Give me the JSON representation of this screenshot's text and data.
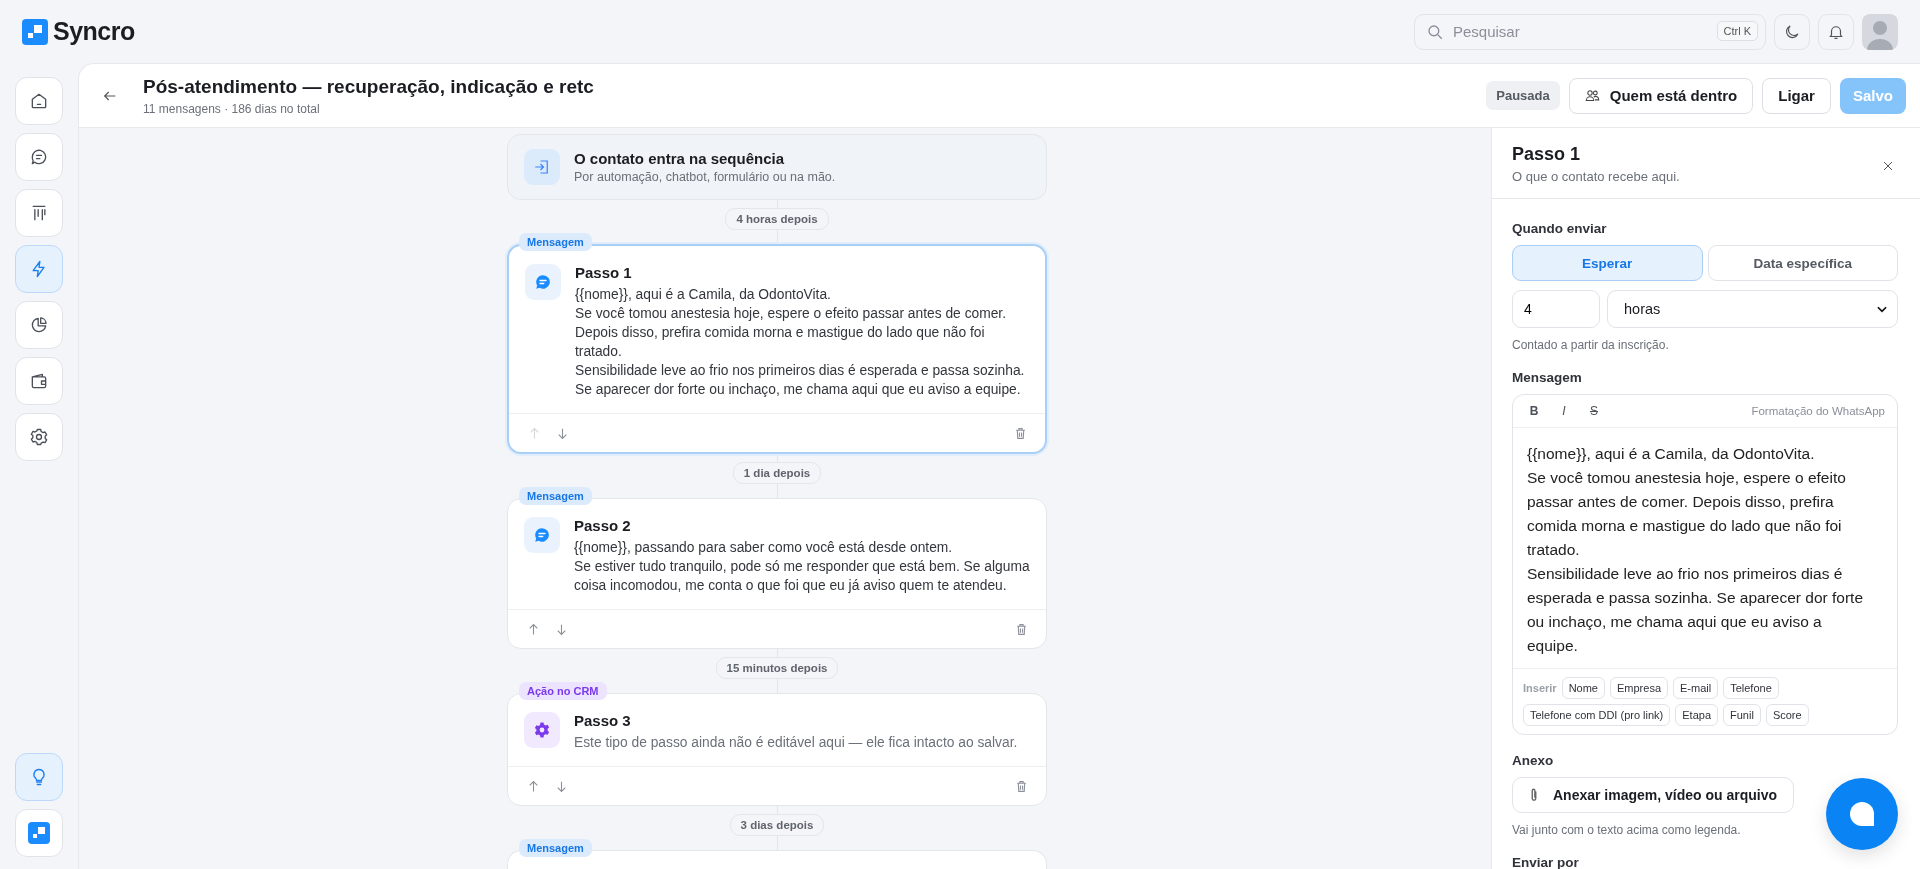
{
  "app": {
    "logo": "Syncro"
  },
  "search": {
    "placeholder": "Pesquisar",
    "shortcut": "Ctrl K"
  },
  "sidebar": {
    "items": [
      {
        "kind": "home",
        "selected": false
      },
      {
        "kind": "chat",
        "selected": false
      },
      {
        "kind": "board",
        "selected": false
      },
      {
        "kind": "automation",
        "selected": true
      },
      {
        "kind": "reports",
        "selected": false
      },
      {
        "kind": "wallet",
        "selected": false
      },
      {
        "kind": "settings",
        "selected": false
      }
    ],
    "bottom_items": [
      {
        "kind": "bulb",
        "selected": true
      },
      {
        "kind": "logo",
        "selected": false
      }
    ]
  },
  "header": {
    "title": "Pós-atendimento — recuperação, indicação e retc",
    "subtitle": "11 mensagens · 186 dias no total",
    "actions": [
      {
        "label": "Pausada",
        "kind": "status"
      },
      {
        "label": "Quem está dentro",
        "kind": "people"
      },
      {
        "label": "Ligar",
        "kind": "plain"
      },
      {
        "label": "Salvo",
        "kind": "primary",
        "disabled": true
      }
    ]
  },
  "flow": {
    "entry": {
      "title": "O contato entra na sequência",
      "subtitle": "Por automação, chatbot, formulário ou na mão."
    },
    "steps": [
      {
        "delay": "4 horas depois",
        "tag": "Mensagem",
        "kind": "message",
        "title": "Passo 1",
        "body": "{{nome}}, aqui é a Camila, da OdontoVita.\nSe você tomou anestesia hoje, espere o efeito passar antes de comer. Depois disso, prefira comida morna e mastigue do lado que não foi tratado.\nSensibilidade leve ao frio nos primeiros dias é esperada e passa sozinha.\nSe aparecer dor forte ou inchaço, me chama aqui que eu aviso a equipe.",
        "selected": true,
        "up_disabled": true
      },
      {
        "delay": "1 dia depois",
        "tag": "Mensagem",
        "kind": "message",
        "title": "Passo 2",
        "body": "{{nome}}, passando para saber como você está desde ontem.\nSe estiver tudo tranquilo, pode só me responder que está bem. Se alguma coisa incomodou, me conta o que foi que eu já aviso quem te atendeu.",
        "selected": false,
        "up_disabled": false
      },
      {
        "delay": "15 minutos depois",
        "tag": "Ação no CRM",
        "kind": "crm",
        "title": "Passo 3",
        "body": "Este tipo de passo ainda não é editável aqui — ele fica intacto ao salvar.",
        "selected": false,
        "up_disabled": false
      }
    ],
    "next": {
      "delay": "3 dias depois",
      "tag": "Mensagem",
      "kind": "message"
    }
  },
  "panel": {
    "title": "Passo 1",
    "subtitle": "O que o contato recebe aqui.",
    "when_label": "Quando enviar",
    "modes": [
      {
        "label": "Esperar",
        "selected": true
      },
      {
        "label": "Data específica",
        "selected": false
      }
    ],
    "amount": "4",
    "unit": "horas",
    "hint": "Contado a partir da inscrição.",
    "message_label": "Mensagem",
    "format_buttons": [
      {
        "label": "B",
        "kind": "bold"
      },
      {
        "label": "I",
        "kind": "italic"
      },
      {
        "label": "S",
        "kind": "strike"
      }
    ],
    "format_hint": "Formatação do WhatsApp",
    "message": "{{nome}}, aqui é a Camila, da OdontoVita.\nSe você tomou anestesia hoje, espere o efeito passar antes de comer. Depois disso, prefira comida morna e mastigue do lado que não foi tratado.\nSensibilidade leve ao frio nos primeiros dias é esperada e passa sozinha. Se aparecer dor forte ou inchaço, me chama aqui que eu aviso a equipe.",
    "insert_label": "Inserir",
    "variables": [
      "Nome",
      "Empresa",
      "E-mail",
      "Telefone",
      "Telefone com DDI (pro link)",
      "Etapa",
      "Funil",
      "Score"
    ],
    "attachment_label": "Anexo",
    "attach_button": "Anexar imagem, vídeo ou arquivo",
    "attachment_hint": "Vai junto com o texto acima como legenda.",
    "send_label": "Enviar por"
  }
}
